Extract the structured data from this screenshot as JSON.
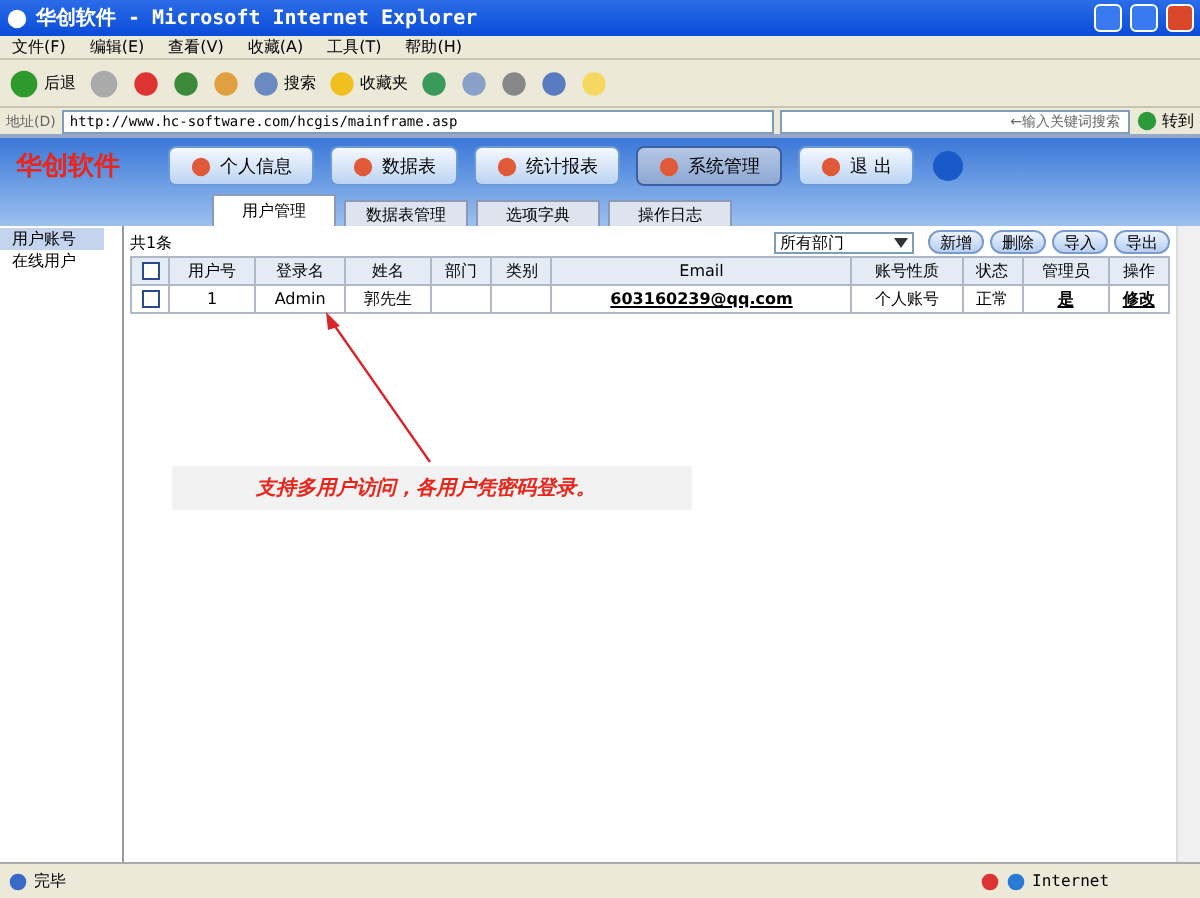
{
  "window": {
    "title": "华创软件 - Microsoft Internet Explorer"
  },
  "menu": [
    "文件(F)",
    "编辑(E)",
    "查看(V)",
    "收藏(A)",
    "工具(T)",
    "帮助(H)"
  ],
  "toolbar": {
    "back": "后退",
    "search": "搜索",
    "favorites": "收藏夹"
  },
  "address": {
    "label": "地址(D)",
    "url": "http://www.hc-software.com/hcgis/mainframe.asp",
    "search_placeholder": "←输入关键词搜索",
    "go": "转到"
  },
  "app": {
    "logo": "华创软件",
    "nav": [
      {
        "label": "个人信息",
        "selected": false
      },
      {
        "label": "数据表",
        "selected": false
      },
      {
        "label": "统计报表",
        "selected": false
      },
      {
        "label": "系统管理",
        "selected": true
      },
      {
        "label": "退 出",
        "selected": false
      }
    ],
    "tabs": [
      {
        "label": "用户管理",
        "selected": true
      },
      {
        "label": "数据表管理",
        "selected": false
      },
      {
        "label": "选项字典",
        "selected": false
      },
      {
        "label": "操作日志",
        "selected": false
      }
    ]
  },
  "sidebar": {
    "items": [
      {
        "label": "用户账号",
        "selected": true
      },
      {
        "label": "在线用户",
        "selected": false
      }
    ]
  },
  "table": {
    "select_all_checked": false,
    "count": "共1条",
    "department_filter": "所有部门",
    "buttons": [
      "新增",
      "删除",
      "导入",
      "导出"
    ],
    "columns": [
      "用户号",
      "登录名",
      "姓名",
      "部门",
      "类别",
      "Email",
      "账号性质",
      "状态",
      "管理员",
      "操作"
    ],
    "rows": [
      {
        "checked": false,
        "cells": [
          "1",
          "Admin",
          "郭先生",
          "",
          "",
          "603160239@qq.com",
          "个人账号",
          "正常",
          "是",
          "修改"
        ]
      }
    ]
  },
  "annotation": "支持多用户访问，各用户凭密码登录。",
  "status_bar": {
    "text": "完毕",
    "zone": "Internet"
  }
}
